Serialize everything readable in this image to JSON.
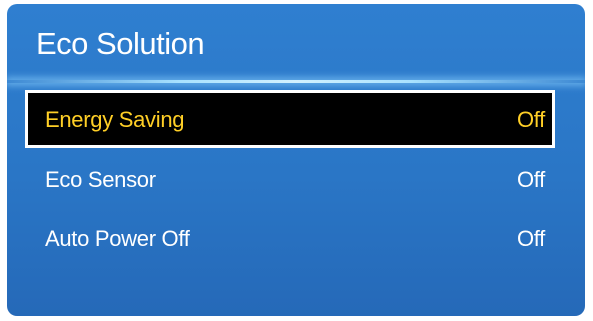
{
  "menu": {
    "title": "Eco Solution",
    "items": [
      {
        "label": "Energy Saving",
        "value": "Off",
        "selected": true
      },
      {
        "label": "Eco Sensor",
        "value": "Off",
        "selected": false
      },
      {
        "label": "Auto Power Off",
        "value": "Off",
        "selected": false
      }
    ]
  },
  "colors": {
    "panel_background": "#2a76c6",
    "highlight_background": "#000000",
    "highlight_text": "#ffcf26",
    "text": "#ffffff"
  }
}
